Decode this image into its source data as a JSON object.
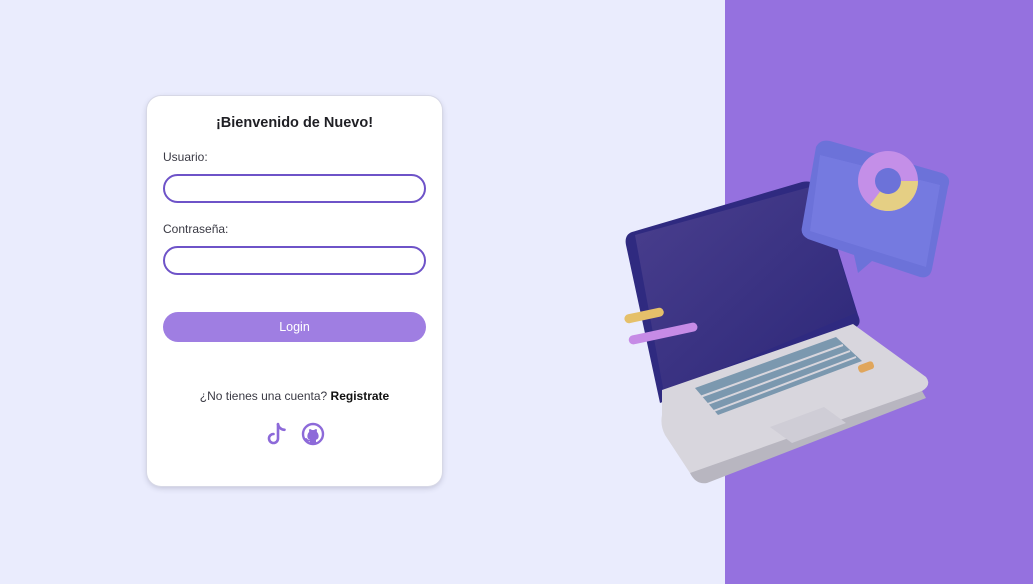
{
  "login_card": {
    "title": "¡Bienvenido de Nuevo!",
    "username_label": "Usuario:",
    "username_value": "",
    "password_label": "Contraseña:",
    "password_value": "",
    "login_button": "Login",
    "signup_prompt": "¿No tienes una cuenta?",
    "signup_link": "Registrate",
    "social_icons": [
      "tiktok-icon",
      "github-icon"
    ]
  },
  "colors": {
    "page_background": "#eaecfd",
    "accent_panel": "#9571df",
    "login_button": "#9f7ee2",
    "input_border": "#6e53c8",
    "icon_color": "#8d6ad9"
  },
  "illustration": "laptop-with-chart-icon"
}
